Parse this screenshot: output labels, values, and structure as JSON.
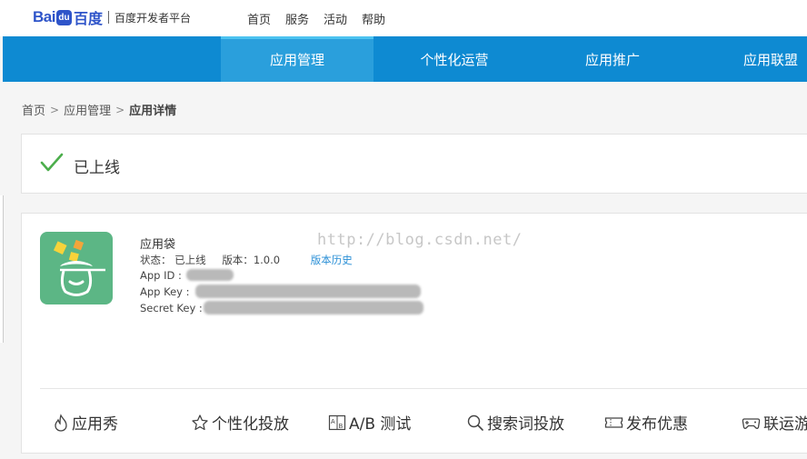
{
  "brand": {
    "logo_latin": "Bai",
    "logo_paw": "du",
    "logo_cn": "百度",
    "subtitle": "百度开发者平台"
  },
  "top_nav": [
    "首页",
    "服务",
    "活动",
    "帮助"
  ],
  "main_nav": {
    "tabs": [
      "应用管理",
      "个性化运营",
      "应用推广",
      "应用联盟"
    ],
    "active_index": 0
  },
  "breadcrumb": {
    "items": [
      "首页",
      "应用管理"
    ],
    "current": "应用详情"
  },
  "status_card": {
    "icon": "check-icon",
    "text": "已上线"
  },
  "app": {
    "name": "应用袋",
    "status_label": "状态：",
    "status_value": "已上线",
    "version_label": "版本：",
    "version_value": "1.0.0",
    "history_link": "版本历史",
    "app_id_label": "App ID :",
    "app_key_label": "App Key :",
    "secret_key_label": "Secret Key :",
    "icon_color": "#5cb685"
  },
  "watermark": "http://blog.csdn.net/",
  "features": [
    {
      "icon": "flame-icon",
      "label": "应用秀"
    },
    {
      "icon": "star-icon",
      "label": "个性化投放"
    },
    {
      "icon": "ab-test-icon",
      "label": "A/B 测试"
    },
    {
      "icon": "search-icon",
      "label": "搜索词投放"
    },
    {
      "icon": "ticket-icon",
      "label": "发布优惠"
    },
    {
      "icon": "gamepad-icon",
      "label": "联运游"
    }
  ],
  "colors": {
    "nav_blue": "#0e8ad2",
    "nav_active": "#2a9fdc",
    "brand_blue": "#2e54c9",
    "success_green": "#4cae4c",
    "link_blue": "#2a8fd6"
  }
}
